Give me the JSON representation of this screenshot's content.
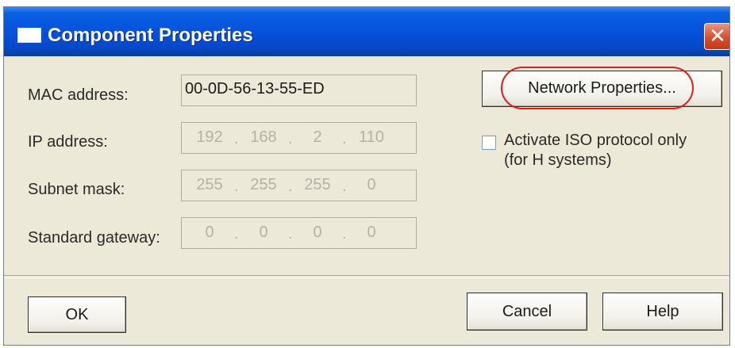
{
  "window": {
    "title": "Component Properties",
    "close_symbol": "✕",
    "title_icon": "window-icon"
  },
  "fields": {
    "mac_label": "MAC address:",
    "mac_value": "00-0D-56-13-55-ED",
    "ip_label": "IP address:",
    "ip_octets": [
      "192",
      "168",
      "2",
      "110"
    ],
    "subnet_label": "Subnet mask:",
    "subnet_octets": [
      "255",
      "255",
      "255",
      "0"
    ],
    "gateway_label": "Standard gateway:",
    "gateway_octets": [
      "0",
      "0",
      "0",
      "0"
    ],
    "octet_separator": "."
  },
  "network_properties_button": "Network Properties...",
  "iso_checkbox": {
    "checked": false,
    "label_line1": "Activate ISO protocol only",
    "label_line2": "(for H systems)"
  },
  "buttons": {
    "ok": "OK",
    "cancel": "Cancel",
    "help": "Help"
  },
  "colors": {
    "titlebar": "#0550dc",
    "dialog_bg": "#ece9d8",
    "highlight_ellipse": "#e01b1b",
    "disabled_text": "#b4b2a6"
  }
}
